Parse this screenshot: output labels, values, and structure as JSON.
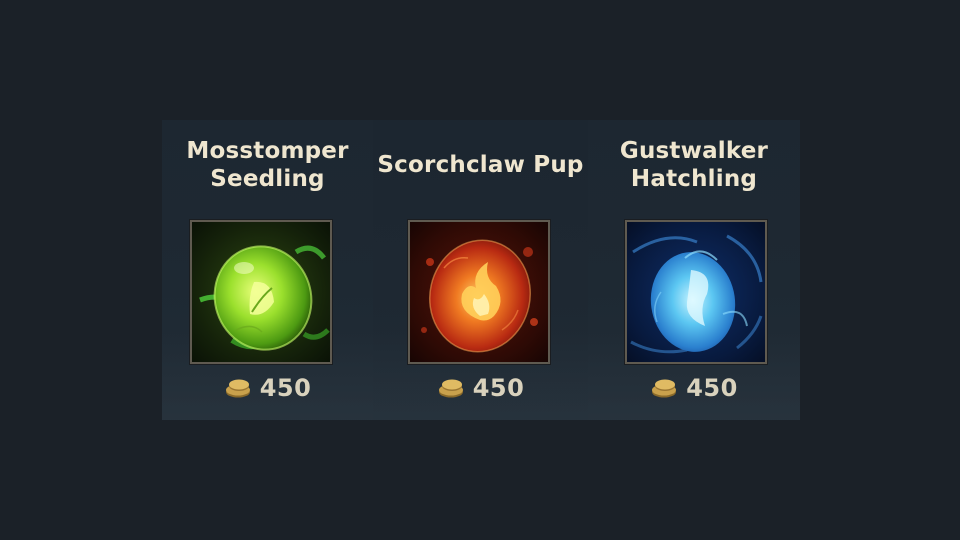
{
  "store": {
    "items": [
      {
        "title_lines": [
          "Mosstomper",
          "Seedling"
        ],
        "icon": "green-leaf-egg-icon",
        "price": "450",
        "currency_icon": "gold-coin-icon",
        "theme_color": "#7fd13a"
      },
      {
        "title_lines": [
          "Scorchclaw Pup"
        ],
        "icon": "red-flame-egg-icon",
        "price": "450",
        "currency_icon": "gold-coin-icon",
        "theme_color": "#e2502a"
      },
      {
        "title_lines": [
          "Gustwalker",
          "Hatchling"
        ],
        "icon": "blue-wind-egg-icon",
        "price": "450",
        "currency_icon": "gold-coin-icon",
        "theme_color": "#4fb8ee"
      }
    ]
  }
}
